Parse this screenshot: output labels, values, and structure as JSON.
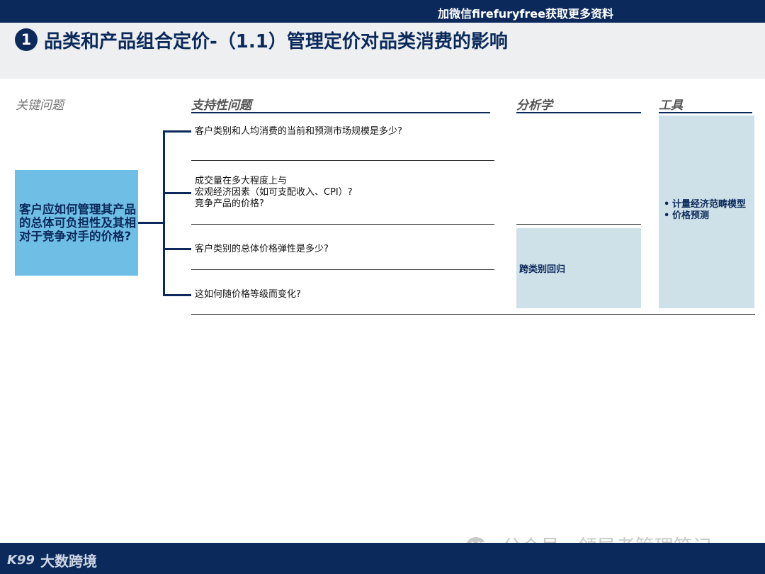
{
  "header": {
    "banner_text": "加微信firefuryfree获取更多资料",
    "title_number": "1",
    "title": "品类和产品组合定价-（1.1）管理定价对品类消费的影响"
  },
  "columns": {
    "key_question": "关键问题",
    "supporting": "支持性问题",
    "analysis": "分析学",
    "tools": "工具"
  },
  "key_question_box": "客户应如何管理其产品的总体可负担性及其相对于竞争对手的价格?",
  "supporting_questions": [
    "客户类别和人均消费的当前和预测市场规模是多少?",
    "成交量在多大程度上与\n宏观经济因素（如可支配收入、CPI）?\n竞争产品的价格?",
    "客户类别的总体价格弹性是多少?",
    "这如何随价格等级而变化?"
  ],
  "analysis_label": "跨类别回归",
  "tools": [
    "计量经济范畴模型",
    "价格预测"
  ],
  "watermark": "公众号 · 领导者管理笔记",
  "footer": {
    "logo_mark": "K99",
    "logo_text": "大数跨境"
  },
  "colors": {
    "navy": "#0b2a5b",
    "key_box": "#6ebee6",
    "light_box": "#cfe1e8"
  }
}
